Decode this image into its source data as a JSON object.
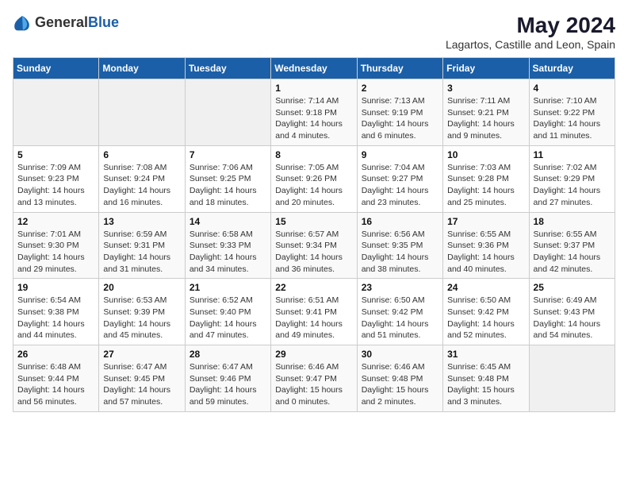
{
  "logo": {
    "general": "General",
    "blue": "Blue"
  },
  "header": {
    "title": "May 2024",
    "subtitle": "Lagartos, Castille and Leon, Spain"
  },
  "weekdays": [
    "Sunday",
    "Monday",
    "Tuesday",
    "Wednesday",
    "Thursday",
    "Friday",
    "Saturday"
  ],
  "weeks": [
    [
      {
        "day": "",
        "sunrise": "",
        "sunset": "",
        "daylight": ""
      },
      {
        "day": "",
        "sunrise": "",
        "sunset": "",
        "daylight": ""
      },
      {
        "day": "",
        "sunrise": "",
        "sunset": "",
        "daylight": ""
      },
      {
        "day": "1",
        "sunrise": "Sunrise: 7:14 AM",
        "sunset": "Sunset: 9:18 PM",
        "daylight": "Daylight: 14 hours and 4 minutes."
      },
      {
        "day": "2",
        "sunrise": "Sunrise: 7:13 AM",
        "sunset": "Sunset: 9:19 PM",
        "daylight": "Daylight: 14 hours and 6 minutes."
      },
      {
        "day": "3",
        "sunrise": "Sunrise: 7:11 AM",
        "sunset": "Sunset: 9:21 PM",
        "daylight": "Daylight: 14 hours and 9 minutes."
      },
      {
        "day": "4",
        "sunrise": "Sunrise: 7:10 AM",
        "sunset": "Sunset: 9:22 PM",
        "daylight": "Daylight: 14 hours and 11 minutes."
      }
    ],
    [
      {
        "day": "5",
        "sunrise": "Sunrise: 7:09 AM",
        "sunset": "Sunset: 9:23 PM",
        "daylight": "Daylight: 14 hours and 13 minutes."
      },
      {
        "day": "6",
        "sunrise": "Sunrise: 7:08 AM",
        "sunset": "Sunset: 9:24 PM",
        "daylight": "Daylight: 14 hours and 16 minutes."
      },
      {
        "day": "7",
        "sunrise": "Sunrise: 7:06 AM",
        "sunset": "Sunset: 9:25 PM",
        "daylight": "Daylight: 14 hours and 18 minutes."
      },
      {
        "day": "8",
        "sunrise": "Sunrise: 7:05 AM",
        "sunset": "Sunset: 9:26 PM",
        "daylight": "Daylight: 14 hours and 20 minutes."
      },
      {
        "day": "9",
        "sunrise": "Sunrise: 7:04 AM",
        "sunset": "Sunset: 9:27 PM",
        "daylight": "Daylight: 14 hours and 23 minutes."
      },
      {
        "day": "10",
        "sunrise": "Sunrise: 7:03 AM",
        "sunset": "Sunset: 9:28 PM",
        "daylight": "Daylight: 14 hours and 25 minutes."
      },
      {
        "day": "11",
        "sunrise": "Sunrise: 7:02 AM",
        "sunset": "Sunset: 9:29 PM",
        "daylight": "Daylight: 14 hours and 27 minutes."
      }
    ],
    [
      {
        "day": "12",
        "sunrise": "Sunrise: 7:01 AM",
        "sunset": "Sunset: 9:30 PM",
        "daylight": "Daylight: 14 hours and 29 minutes."
      },
      {
        "day": "13",
        "sunrise": "Sunrise: 6:59 AM",
        "sunset": "Sunset: 9:31 PM",
        "daylight": "Daylight: 14 hours and 31 minutes."
      },
      {
        "day": "14",
        "sunrise": "Sunrise: 6:58 AM",
        "sunset": "Sunset: 9:33 PM",
        "daylight": "Daylight: 14 hours and 34 minutes."
      },
      {
        "day": "15",
        "sunrise": "Sunrise: 6:57 AM",
        "sunset": "Sunset: 9:34 PM",
        "daylight": "Daylight: 14 hours and 36 minutes."
      },
      {
        "day": "16",
        "sunrise": "Sunrise: 6:56 AM",
        "sunset": "Sunset: 9:35 PM",
        "daylight": "Daylight: 14 hours and 38 minutes."
      },
      {
        "day": "17",
        "sunrise": "Sunrise: 6:55 AM",
        "sunset": "Sunset: 9:36 PM",
        "daylight": "Daylight: 14 hours and 40 minutes."
      },
      {
        "day": "18",
        "sunrise": "Sunrise: 6:55 AM",
        "sunset": "Sunset: 9:37 PM",
        "daylight": "Daylight: 14 hours and 42 minutes."
      }
    ],
    [
      {
        "day": "19",
        "sunrise": "Sunrise: 6:54 AM",
        "sunset": "Sunset: 9:38 PM",
        "daylight": "Daylight: 14 hours and 44 minutes."
      },
      {
        "day": "20",
        "sunrise": "Sunrise: 6:53 AM",
        "sunset": "Sunset: 9:39 PM",
        "daylight": "Daylight: 14 hours and 45 minutes."
      },
      {
        "day": "21",
        "sunrise": "Sunrise: 6:52 AM",
        "sunset": "Sunset: 9:40 PM",
        "daylight": "Daylight: 14 hours and 47 minutes."
      },
      {
        "day": "22",
        "sunrise": "Sunrise: 6:51 AM",
        "sunset": "Sunset: 9:41 PM",
        "daylight": "Daylight: 14 hours and 49 minutes."
      },
      {
        "day": "23",
        "sunrise": "Sunrise: 6:50 AM",
        "sunset": "Sunset: 9:42 PM",
        "daylight": "Daylight: 14 hours and 51 minutes."
      },
      {
        "day": "24",
        "sunrise": "Sunrise: 6:50 AM",
        "sunset": "Sunset: 9:42 PM",
        "daylight": "Daylight: 14 hours and 52 minutes."
      },
      {
        "day": "25",
        "sunrise": "Sunrise: 6:49 AM",
        "sunset": "Sunset: 9:43 PM",
        "daylight": "Daylight: 14 hours and 54 minutes."
      }
    ],
    [
      {
        "day": "26",
        "sunrise": "Sunrise: 6:48 AM",
        "sunset": "Sunset: 9:44 PM",
        "daylight": "Daylight: 14 hours and 56 minutes."
      },
      {
        "day": "27",
        "sunrise": "Sunrise: 6:47 AM",
        "sunset": "Sunset: 9:45 PM",
        "daylight": "Daylight: 14 hours and 57 minutes."
      },
      {
        "day": "28",
        "sunrise": "Sunrise: 6:47 AM",
        "sunset": "Sunset: 9:46 PM",
        "daylight": "Daylight: 14 hours and 59 minutes."
      },
      {
        "day": "29",
        "sunrise": "Sunrise: 6:46 AM",
        "sunset": "Sunset: 9:47 PM",
        "daylight": "Daylight: 15 hours and 0 minutes."
      },
      {
        "day": "30",
        "sunrise": "Sunrise: 6:46 AM",
        "sunset": "Sunset: 9:48 PM",
        "daylight": "Daylight: 15 hours and 2 minutes."
      },
      {
        "day": "31",
        "sunrise": "Sunrise: 6:45 AM",
        "sunset": "Sunset: 9:48 PM",
        "daylight": "Daylight: 15 hours and 3 minutes."
      },
      {
        "day": "",
        "sunrise": "",
        "sunset": "",
        "daylight": ""
      }
    ]
  ]
}
